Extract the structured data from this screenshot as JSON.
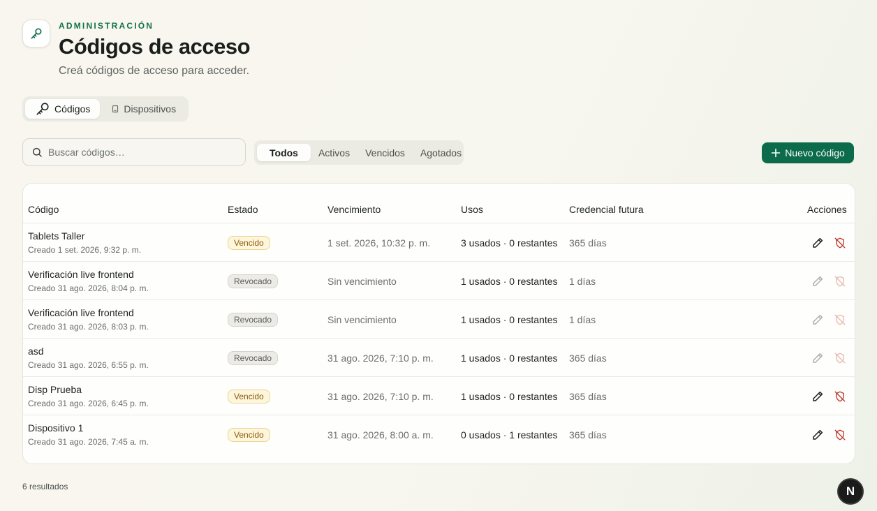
{
  "header": {
    "eyebrow": "ADMINISTRACIÓN",
    "title": "Códigos de acceso",
    "subtitle": "Creá códigos de acceso para acceder."
  },
  "tabs": [
    {
      "label": "Códigos",
      "icon": "key-icon",
      "active": true
    },
    {
      "label": "Dispositivos",
      "icon": "device-icon",
      "active": false
    }
  ],
  "search": {
    "placeholder": "Buscar códigos…",
    "value": ""
  },
  "filters": [
    {
      "label": "Todos",
      "active": true
    },
    {
      "label": "Activos",
      "active": false
    },
    {
      "label": "Vencidos",
      "active": false
    },
    {
      "label": "Agotados",
      "active": false
    }
  ],
  "new_button": {
    "label": "Nuevo código",
    "icon": "plus-icon"
  },
  "table": {
    "headers": {
      "code": "Código",
      "status": "Estado",
      "expiry": "Vencimiento",
      "uses": "Usos",
      "credential": "Credencial futura",
      "actions": "Acciones"
    },
    "rows": [
      {
        "name": "Tablets Taller",
        "created": "Creado 1 set. 2026, 9:32 p. m.",
        "status": "Vencido",
        "status_kind": "vencido",
        "expiry": "1 set. 2026, 10:32 p. m.",
        "uses": "3 usados · 0 restantes",
        "credential": "365 días",
        "actions_enabled": true
      },
      {
        "name": "Verificación live frontend",
        "created": "Creado 31 ago. 2026, 8:04 p. m.",
        "status": "Revocado",
        "status_kind": "revocado",
        "expiry": "Sin vencimiento",
        "uses": "1 usados · 0 restantes",
        "credential": "1 días",
        "actions_enabled": false
      },
      {
        "name": "Verificación live frontend",
        "created": "Creado 31 ago. 2026, 8:03 p. m.",
        "status": "Revocado",
        "status_kind": "revocado",
        "expiry": "Sin vencimiento",
        "uses": "1 usados · 0 restantes",
        "credential": "1 días",
        "actions_enabled": false
      },
      {
        "name": "asd",
        "created": "Creado 31 ago. 2026, 6:55 p. m.",
        "status": "Revocado",
        "status_kind": "revocado",
        "expiry": "31 ago. 2026, 7:10 p. m.",
        "uses": "1 usados · 0 restantes",
        "credential": "365 días",
        "actions_enabled": false
      },
      {
        "name": "Disp Prueba",
        "created": "Creado 31 ago. 2026, 6:45 p. m.",
        "status": "Vencido",
        "status_kind": "vencido",
        "expiry": "31 ago. 2026, 7:10 p. m.",
        "uses": "1 usados · 0 restantes",
        "credential": "365 días",
        "actions_enabled": true
      },
      {
        "name": "Dispositivo 1",
        "created": "Creado 31 ago. 2026, 7:45 a. m.",
        "status": "Vencido",
        "status_kind": "vencido",
        "expiry": "31 ago. 2026, 8:00 a. m.",
        "uses": "0 usados · 1 restantes",
        "credential": "365 días",
        "actions_enabled": true
      }
    ]
  },
  "results_text": "6 resultados",
  "corner_badge": "N",
  "colors": {
    "accent": "#0b6b4a",
    "danger": "#c0392b"
  }
}
